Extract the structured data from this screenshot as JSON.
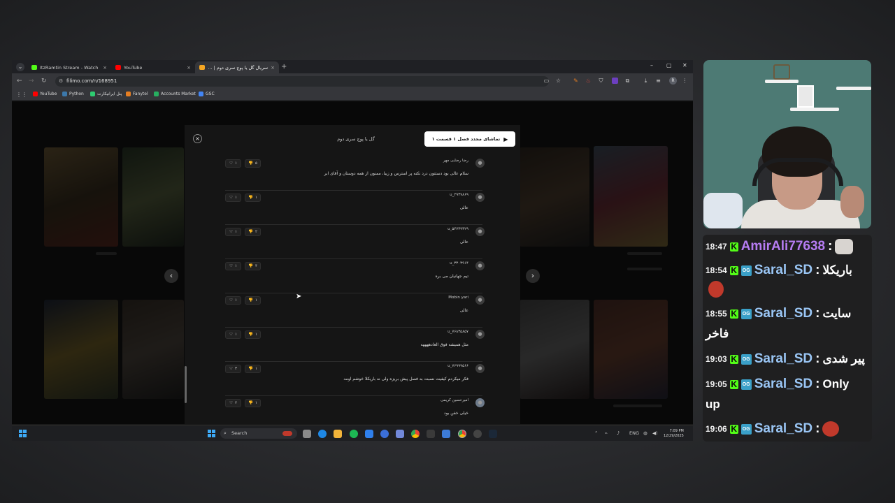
{
  "browser": {
    "tabs": [
      {
        "title": "ItzRamtin Stream - Watch Live",
        "fav_color": "#53fc18"
      },
      {
        "title": "YouTube",
        "fav_color": "#ff0000"
      },
      {
        "title": "سریال گل یا پوچ سری دوم | ...",
        "fav_color": "#f5a623"
      }
    ],
    "tab_close": "×",
    "new_tab": "+",
    "window_controls": [
      "–",
      "▢",
      "✕"
    ],
    "url": "filimo.com/n/168951",
    "profile_initial": "R",
    "bookmarks": [
      {
        "label": "YouTube",
        "color": "#ff0000"
      },
      {
        "label": "Python",
        "color": "#3c78aa"
      },
      {
        "label": "پنل ایرانیکارت",
        "color": "#2ecc71"
      },
      {
        "label": "Fanytel",
        "color": "#e67e22"
      },
      {
        "label": "Accounts Market",
        "color": "#27ae60"
      },
      {
        "label": "GSC",
        "color": "#4285f4"
      }
    ]
  },
  "modal": {
    "title": "گل یا پوچ سری دوم",
    "replay_button": "تماشای مجدد فصل ۱ قسمت ۱",
    "close": "×",
    "comments": [
      {
        "user": "رضا رضایی مهر",
        "text": "سلام عالی بود دستتون درد نکنه پر استرس و زیبا، ممنون از همه دوستان و آقای ابر",
        "likes": "۱",
        "dislikes": "۵"
      },
      {
        "user": "u_۲۹۳۷۸۶۹",
        "text": "عالی",
        "likes": "۱",
        "dislikes": "۱"
      },
      {
        "user": "u_۵۴۷۳۹۳۲۹",
        "text": "عالی",
        "likes": "۱",
        "dislikes": "۲"
      },
      {
        "user": "u_۳۳۰۳۹۱۴",
        "text": "تیم جهانیان می بره",
        "likes": "۱",
        "dislikes": "۴"
      },
      {
        "user": "Mobin yari",
        "text": "عالی",
        "likes": "۱",
        "dislikes": "۱"
      },
      {
        "user": "u_۷۶۸۳۵۸۵۷",
        "text": "مثل همیشه فوق العادههههه",
        "likes": "۱",
        "dislikes": "۱"
      },
      {
        "user": "u_۷۶۹۹۹۵۶۶",
        "text": "فکر میکردم کیفیت نسبت به فصل پیش بریزه ولی نه باریکلا خوشم اومد",
        "likes": "۳",
        "dislikes": "۱"
      },
      {
        "user": "امیرحسین کریمی",
        "text": "خیلی خفن بود",
        "likes": "۲",
        "dislikes": "۱"
      }
    ]
  },
  "taskbar": {
    "search_label": "Search",
    "lang": "ENG",
    "time": "7:09 PM",
    "date": "12/29/2025"
  },
  "chat": {
    "badge_k": "K",
    "badge_og": "OG",
    "messages": [
      {
        "time": "18:47",
        "user": "AmirAli77638",
        "user_color": "#b67cf2",
        "text": "",
        "emote_color": "#d8d4d0"
      },
      {
        "time": "18:54",
        "user": "Saral_SD",
        "user_color": "#9ac6f5",
        "text": "باریکلا",
        "emote_color": "#c0392b"
      },
      {
        "time": "18:55",
        "user": "Saral_SD",
        "user_color": "#9ac6f5",
        "text": "سایت",
        "wrap": "فاخر"
      },
      {
        "time": "19:03",
        "user": "Saral_SD",
        "user_color": "#9ac6f5",
        "text": "پیر شدی"
      },
      {
        "time": "19:05",
        "user": "Saral_SD",
        "user_color": "#9ac6f5",
        "text": "Only",
        "wrap": "up"
      },
      {
        "time": "19:06",
        "user": "Saral_SD",
        "user_color": "#9ac6f5",
        "text": "",
        "emote_color": "#c0392b"
      }
    ]
  }
}
